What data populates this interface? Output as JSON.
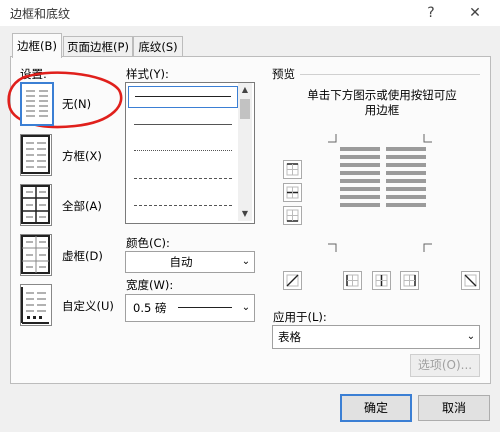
{
  "window": {
    "title": "边框和底纹",
    "help_label": "?",
    "close_label": "✕"
  },
  "tabs": [
    {
      "label": "边框(B)"
    },
    {
      "label": "页面边框(P)"
    },
    {
      "label": "底纹(S)"
    }
  ],
  "settings": {
    "heading": "设置:",
    "options": [
      {
        "label": "无(N)"
      },
      {
        "label": "方框(X)"
      },
      {
        "label": "全部(A)"
      },
      {
        "label": "虚框(D)"
      },
      {
        "label": "自定义(U)"
      }
    ]
  },
  "style": {
    "heading": "样式(Y):",
    "color_label": "颜色(C):",
    "color_value": "自动",
    "width_label": "宽度(W):",
    "width_value": "0.5 磅"
  },
  "preview": {
    "heading": "预览",
    "instruction": "单击下方图示或使用按钮可应用边框",
    "apply_label": "应用于(L):",
    "apply_value": "表格",
    "options_button": "选项(O)..."
  },
  "footer": {
    "ok": "确定",
    "cancel": "取消"
  },
  "colors": {
    "accent": "#3b7fd4",
    "annotation": "#e0201c"
  }
}
